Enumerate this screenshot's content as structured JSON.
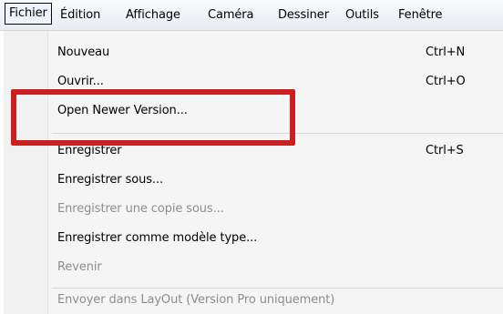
{
  "menubar": {
    "items": [
      {
        "label": "Fichier"
      },
      {
        "label": "Édition"
      },
      {
        "label": "Affichage"
      },
      {
        "label": "Caméra"
      },
      {
        "label": "Dessiner"
      },
      {
        "label": "Outils"
      },
      {
        "label": "Fenêtre"
      }
    ]
  },
  "file_menu": {
    "items": [
      {
        "label": "Nouveau",
        "shortcut": "Ctrl+N",
        "enabled": true
      },
      {
        "label": "Ouvrir...",
        "shortcut": "Ctrl+O",
        "enabled": true
      },
      {
        "label": "Open Newer Version...",
        "shortcut": "",
        "enabled": true
      },
      {
        "label": "Enregistrer",
        "shortcut": "Ctrl+S",
        "enabled": true
      },
      {
        "label": "Enregistrer sous...",
        "shortcut": "",
        "enabled": true
      },
      {
        "label": "Enregistrer une copie sous...",
        "shortcut": "",
        "enabled": false
      },
      {
        "label": "Enregistrer comme modèle type...",
        "shortcut": "",
        "enabled": true
      },
      {
        "label": "Revenir",
        "shortcut": "",
        "enabled": false
      },
      {
        "label": "Envoyer dans LayOut (Version Pro uniquement)",
        "shortcut": "",
        "enabled": false
      }
    ]
  },
  "annotation": {
    "color": "#cc1f1f",
    "target": "Open Newer Version..."
  }
}
